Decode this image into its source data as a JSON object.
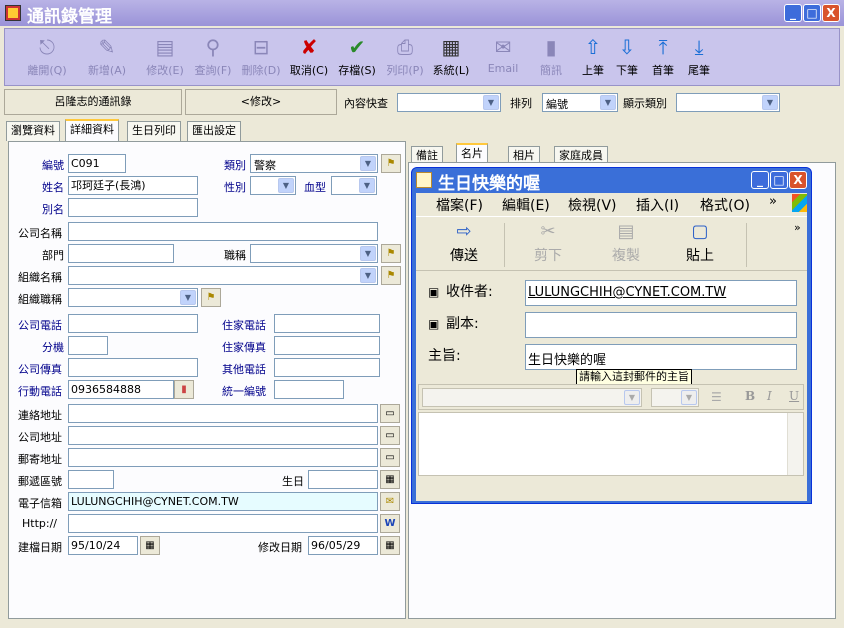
{
  "window": {
    "title": "通訊錄管理",
    "min": "_",
    "max": "□",
    "close": "X"
  },
  "toolbar": [
    {
      "label": "離開(Q)",
      "icon": "exit-icon",
      "glyph": "⎋",
      "enabled": false
    },
    {
      "label": "新增(A)",
      "icon": "new-icon",
      "glyph": "✎",
      "enabled": false
    },
    {
      "label": "修改(E)",
      "icon": "edit-icon",
      "glyph": "▤",
      "enabled": false
    },
    {
      "label": "查詢(F)",
      "icon": "query-icon",
      "glyph": "⚲",
      "enabled": false
    },
    {
      "label": "刪除(D)",
      "icon": "delete-icon",
      "glyph": "⊟",
      "enabled": false
    },
    {
      "label": "取消(C)",
      "icon": "cancel-icon",
      "glyph": "✘",
      "enabled": true
    },
    {
      "label": "存檔(S)",
      "icon": "save-icon",
      "glyph": "✔",
      "enabled": true
    },
    {
      "label": "列印(P)",
      "icon": "print-icon",
      "glyph": "⎙",
      "enabled": false
    },
    {
      "label": "系統(L)",
      "icon": "system-icon",
      "glyph": "▦",
      "enabled": true
    },
    {
      "label": "Email",
      "icon": "email-icon",
      "glyph": "✉",
      "enabled": false
    },
    {
      "label": "簡訊",
      "icon": "sms-icon",
      "glyph": "▮",
      "enabled": false
    },
    {
      "label": "上筆",
      "icon": "prev-record-icon",
      "glyph": "⇧",
      "enabled": true
    },
    {
      "label": "下筆",
      "icon": "next-record-icon",
      "glyph": "⇩",
      "enabled": true
    },
    {
      "label": "首筆",
      "icon": "first-record-icon",
      "glyph": "⤒",
      "enabled": true
    },
    {
      "label": "尾筆",
      "icon": "last-record-icon",
      "glyph": "⤓",
      "enabled": true
    }
  ],
  "infobar": {
    "owner": "呂隆志的通訊錄",
    "mode": "<修改>",
    "content_search_label": "內容快查",
    "content_search_value": "",
    "sort_label": "排列",
    "sort_value": "編號",
    "display_label": "顯示類別",
    "display_value": ""
  },
  "tabs": [
    "瀏覽資料",
    "詳細資料",
    "生日列印",
    "匯出設定"
  ],
  "form": {
    "id_label": "編號",
    "id_value": "C091",
    "category_label": "類別",
    "category_value": "警察",
    "name_label": "姓名",
    "name_value": "邛珂廷子(長鴻)",
    "gender_label": "性別",
    "gender_value": "",
    "blood_label": "血型",
    "blood_value": "",
    "alias_label": "別名",
    "alias_value": "",
    "company_label": "公司名稱",
    "company_value": "",
    "dept_label": "部門",
    "dept_value": "",
    "title_label": "職稱",
    "title_value": "",
    "org_label": "組織名稱",
    "org_value": "",
    "orgtitle_label": "組織職稱",
    "orgtitle_value": "",
    "ophone_label": "公司電話",
    "ophone_value": "",
    "hphone_label": "住家電話",
    "hphone_value": "",
    "ext_label": "分機",
    "ext_value": "",
    "hfax_label": "住家傳真",
    "hfax_value": "",
    "ofax_label": "公司傳真",
    "ofax_value": "",
    "otherphone_label": "其他電話",
    "otherphone_value": "",
    "mobile_label": "行動電話",
    "mobile_value": "0936584888",
    "taxid_label": "統一編號",
    "taxid_value": "",
    "contact_addr_label": "連絡地址",
    "contact_addr_value": "",
    "company_addr_label": "公司地址",
    "company_addr_value": "",
    "mail_addr_label": "郵寄地址",
    "mail_addr_value": "",
    "zip_label": "郵遞區號",
    "zip_value": "",
    "birthday_label": "生日",
    "birthday_value": "",
    "email_label": "電子信箱",
    "email_value": "LULUNGCHIH@CYNET.COM.TW",
    "http_label": "Http://",
    "http_value": "",
    "created_label": "建檔日期",
    "created_value": "95/10/24",
    "modified_label": "修改日期",
    "modified_value": "96/05/29",
    "web_btn": "W"
  },
  "right_tabs": [
    "備註",
    "名片",
    "相片",
    "家庭成員"
  ],
  "mail": {
    "title": "生日快樂的喔",
    "menu": [
      "檔案(F)",
      "編輯(E)",
      "檢視(V)",
      "插入(I)",
      "格式(O)"
    ],
    "menu_more": "»",
    "tools": [
      {
        "label": "傳送",
        "icon": "send-icon",
        "enabled": true
      },
      {
        "label": "剪下",
        "icon": "cut-icon",
        "enabled": false
      },
      {
        "label": "複製",
        "icon": "copy-icon",
        "enabled": false
      },
      {
        "label": "貼上",
        "icon": "paste-icon",
        "enabled": true
      }
    ],
    "tools_more": "»",
    "to_label": "收件者:",
    "to_value": "LULUNGCHIH@CYNET.COM.TW",
    "cc_label": "副本:",
    "cc_value": "",
    "subject_label": "主旨:",
    "subject_value": "生日快樂的喔",
    "tooltip": "請輸入這封郵件的主旨",
    "fmt_bold": "B",
    "fmt_italic": "I",
    "fmt_underline": "U"
  }
}
